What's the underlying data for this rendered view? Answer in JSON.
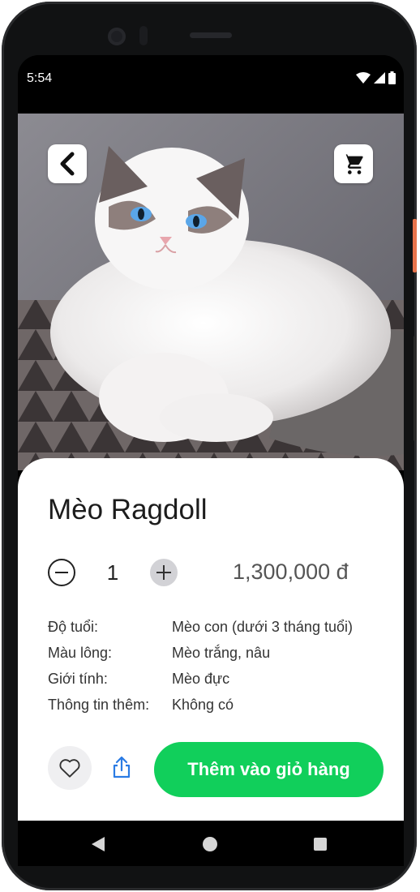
{
  "status_bar": {
    "time": "5:54"
  },
  "product": {
    "name": "Mèo Ragdoll",
    "quantity": "1",
    "price": "1,300,000 đ",
    "details": [
      {
        "label": "Độ tuổi:",
        "value": "Mèo con (dưới 3 tháng tuổi)"
      },
      {
        "label": "Màu lông:",
        "value": "Mèo trắng, nâu"
      },
      {
        "label": "Giới tính:",
        "value": "Mèo đực"
      },
      {
        "label": "Thông tin thêm:",
        "value": "Không có"
      }
    ]
  },
  "actions": {
    "add_to_cart_label": "Thêm vào giỏ hàng"
  },
  "icons": {
    "back": "chevron-left-icon",
    "cart": "shopping-cart-icon",
    "minus": "minus-circle-icon",
    "plus": "plus-circle-icon",
    "favorite": "heart-outline-icon",
    "share": "share-icon"
  },
  "colors": {
    "accent_green": "#11cf5b",
    "share_blue": "#2a7be4",
    "plus_bg": "#d2d2d6"
  }
}
